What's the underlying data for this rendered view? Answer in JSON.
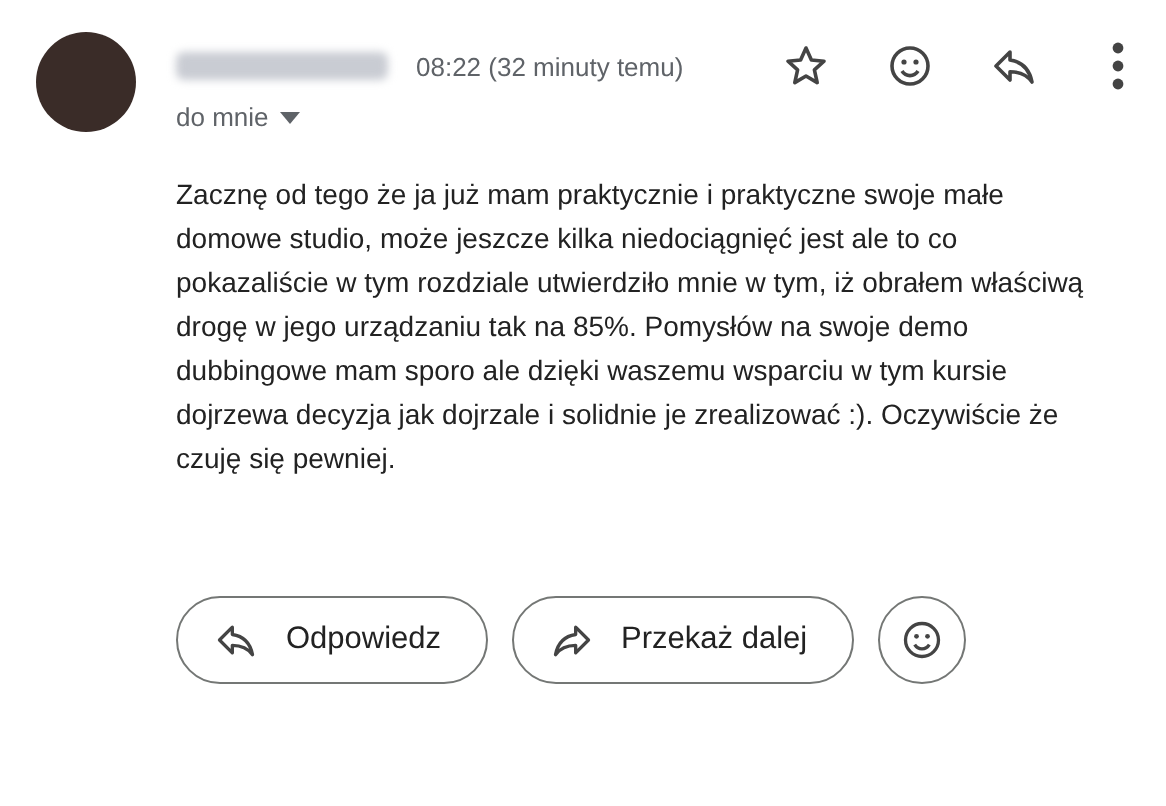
{
  "header": {
    "time": "08:22 (32 minuty temu)",
    "recipient": "do mnie",
    "starred": false
  },
  "body": "Zacznę od tego że ja już mam praktycznie i praktyczne swoje małe domowe studio, może jeszcze kilka niedociągnięć jest ale to co pokazaliście w tym rozdziale utwierdziło mnie w tym, iż obrałem właściwą drogę w jego urządzaniu tak na 85%. Pomysłów na swoje demo dubbingowe mam sporo ale dzięki waszemu wsparciu w tym kursie dojrzewa decyzja jak dojrzale i solidnie je zrealizować :). Oczywiście że czuję się pewniej.",
  "actions": [
    {
      "kind": "reply",
      "label": "Odpowiedz"
    },
    {
      "kind": "forward",
      "label": "Przekaż dalej"
    },
    {
      "kind": "emoji"
    }
  ]
}
